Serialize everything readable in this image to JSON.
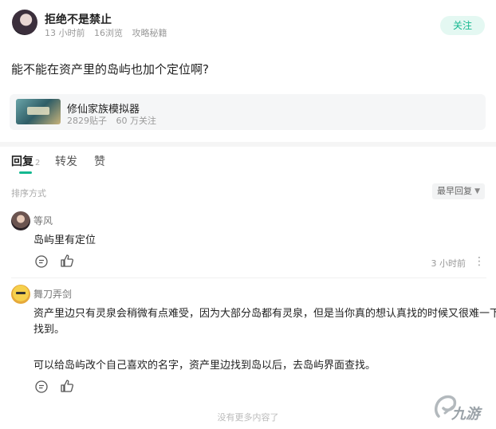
{
  "post": {
    "author": "拒绝不是禁止",
    "time": "13 小时前",
    "views": "16浏览",
    "category": "攻略秘籍",
    "follow_label": "关注",
    "title": "能不能在资产里的岛屿也加个定位啊?"
  },
  "game": {
    "name": "修仙家族模拟器",
    "posts": "2829贴子",
    "followers": "60 万关注"
  },
  "tabs": [
    {
      "label": "回复",
      "count": "2"
    },
    {
      "label": "转发"
    },
    {
      "label": "赞"
    }
  ],
  "sort": {
    "label": "排序方式",
    "selected": "最早回复"
  },
  "replies": [
    {
      "name": "等风",
      "text": "岛屿里有定位",
      "time": "3 小时前"
    },
    {
      "name": "舞刀弄剑",
      "lines": [
        "资产里边只有灵泉会稍微有点难受，因为大部分岛都有灵泉，但是当你真的想认真找的时候又很难一下",
        "找到。",
        "可以给岛屿改个自己喜欢的名字，资产里边找到岛以后，去岛屿界面查找。"
      ]
    }
  ],
  "footer": "没有更多内容了",
  "watermark": "九游",
  "colors": {
    "accent": "#14b890",
    "follow_bg": "#e4f8f2"
  }
}
